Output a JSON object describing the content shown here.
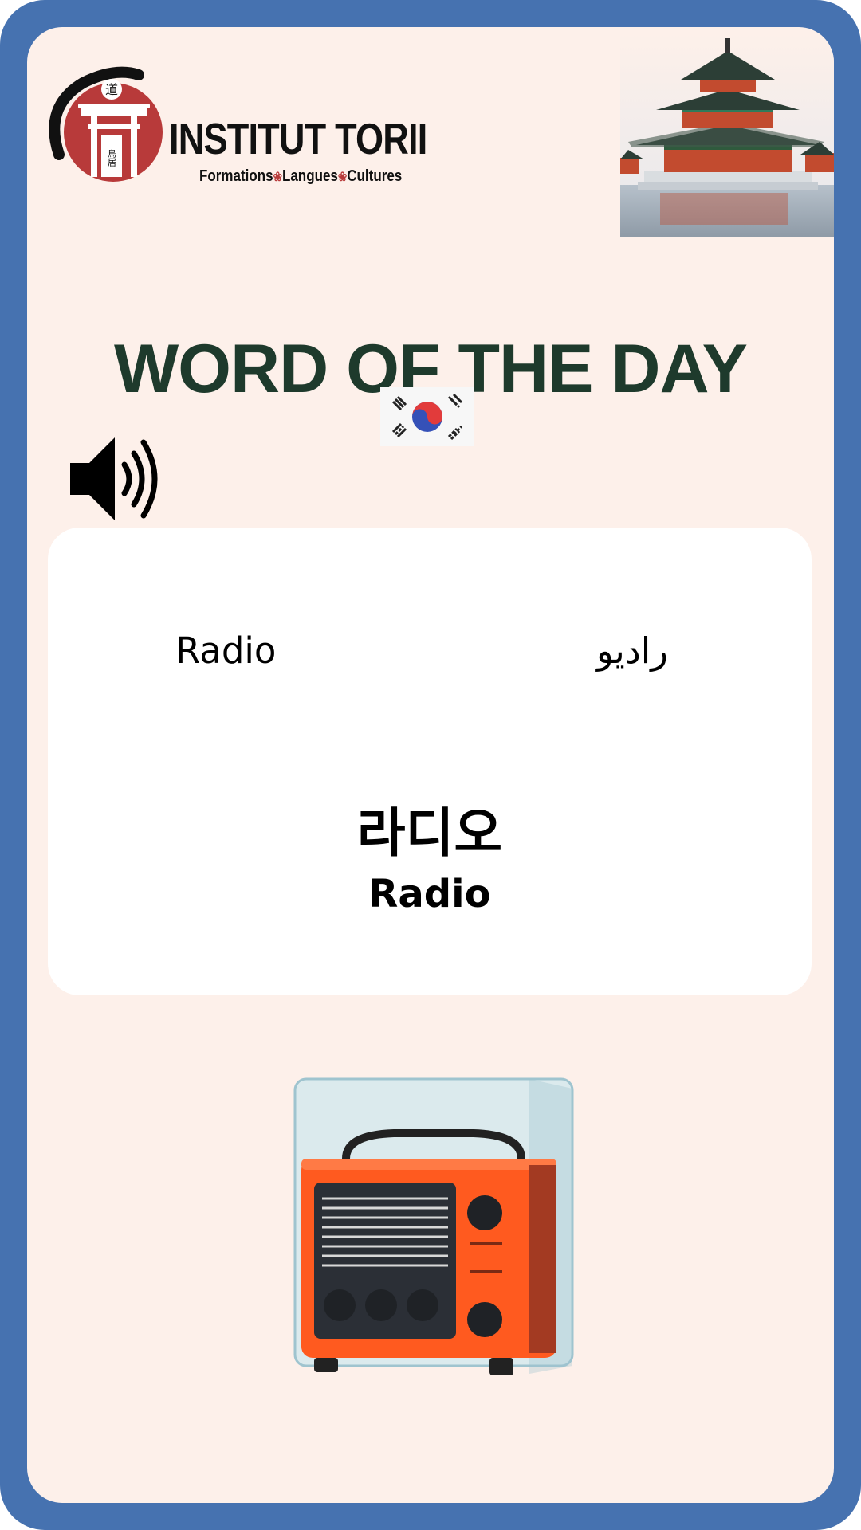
{
  "brand": {
    "name": "INSTITUT TORII",
    "tagline_parts": [
      "Formations",
      "Langues",
      "Cultures"
    ],
    "emblem_glyphs": [
      "道",
      "鳥居"
    ]
  },
  "title": "WORD OF THE DAY",
  "flag": {
    "icon": "south-korea-flag-icon"
  },
  "audio": {
    "icon": "speaker-icon"
  },
  "card": {
    "translation_left": "Radio",
    "translation_right": "راديو",
    "korean_word": "라디오",
    "romanization": "Radio"
  },
  "images": {
    "top_right": "pagoda-photo",
    "bottom": "radio-illustration"
  },
  "colors": {
    "frame": "#4672b0",
    "background": "#fdf0ea",
    "title": "#1e3a2c",
    "card": "#ffffff",
    "accent_red": "#b83a3a",
    "radio_orange": "#ff5a1f"
  }
}
